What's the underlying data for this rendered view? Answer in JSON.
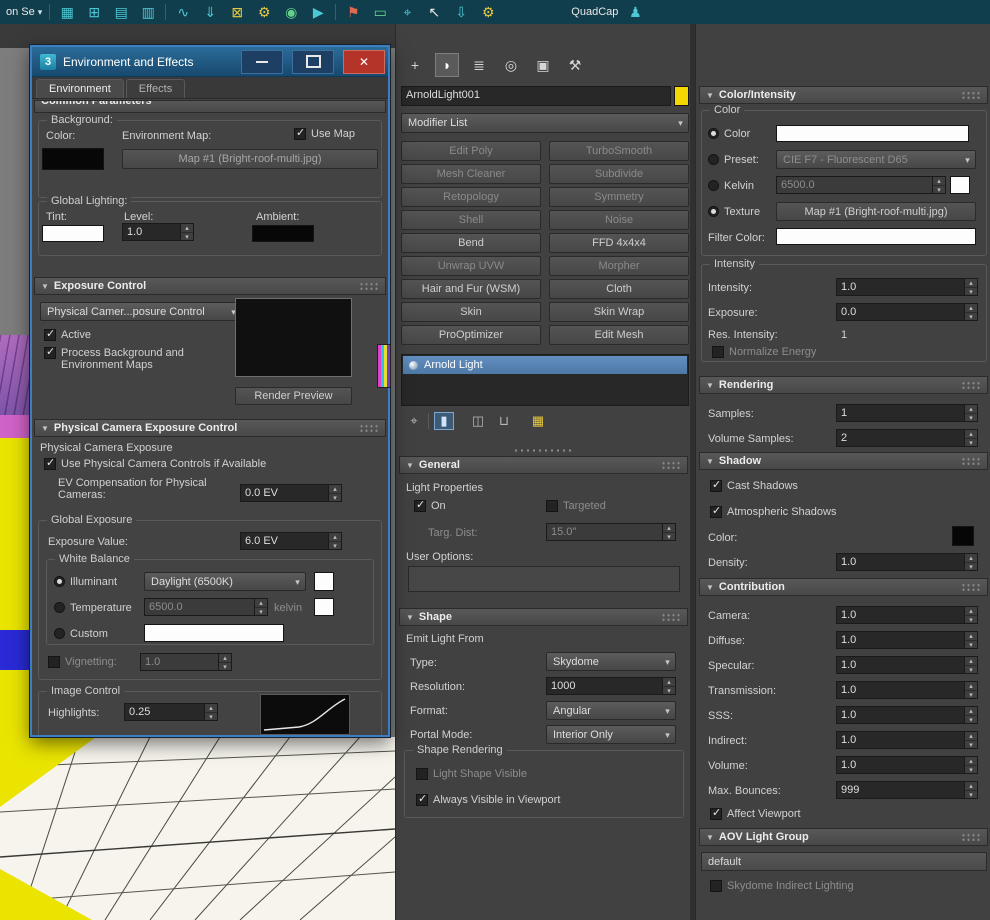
{
  "colors": {
    "accent_blue": "#4d79a7",
    "title_bar_blue": "#1c5a86",
    "close_red": "#b5342a",
    "object_color_yellow": "#f5d800",
    "toolbar_teal": "#113e4d",
    "icon_teal": "#4cc8d4"
  },
  "top_toolbar": {
    "selection_label": "on Se",
    "quadcap_label": "QuadCap",
    "icons": [
      {
        "name": "viewport-layout-icon",
        "glyph": "▦"
      },
      {
        "name": "schematic-view-icon",
        "glyph": "⊞"
      },
      {
        "name": "layer-explorer-icon",
        "glyph": "▤"
      },
      {
        "name": "scene-explorer-icon",
        "glyph": "▥"
      },
      {
        "name": "curve-editor-icon",
        "glyph": "∿"
      },
      {
        "name": "import-icon",
        "glyph": "⇓"
      },
      {
        "name": "uv-editor-icon",
        "glyph": "⊠"
      },
      {
        "name": "gear-icon",
        "glyph": "⚙"
      },
      {
        "name": "camera-icon",
        "glyph": "◉"
      },
      {
        "name": "play-icon",
        "glyph": "▶"
      },
      {
        "name": "flag-icon",
        "glyph": "⚑"
      },
      {
        "name": "monitor-icon",
        "glyph": "▭"
      },
      {
        "name": "target-icon",
        "glyph": "⌖"
      },
      {
        "name": "cursor-icon",
        "glyph": "↖"
      },
      {
        "name": "export-icon",
        "glyph": "⇩"
      },
      {
        "name": "gears-icon",
        "glyph": "⚙"
      }
    ],
    "quadcap_icon": {
      "name": "quadcap-icon",
      "glyph": "♟"
    }
  },
  "env_dialog": {
    "app_icon_glyph": "3",
    "title": "Environment and Effects",
    "tabs": {
      "environment": "Environment",
      "effects": "Effects"
    },
    "common_parameters_header": "Common Parameters",
    "background": {
      "title": "Background:",
      "color_label": "Color:",
      "env_map_label": "Environment Map:",
      "use_map_label": "Use Map",
      "use_map_checked": true,
      "map_button_label": "Map #1 (Bright-roof-multi.jpg)"
    },
    "global_lighting": {
      "title": "Global Lighting:",
      "tint_label": "Tint:",
      "level_label": "Level:",
      "level_value": "1.0",
      "ambient_label": "Ambient:"
    },
    "exposure_control": {
      "header": "Exposure Control",
      "mode_value": "Physical Camer...posure Control",
      "active_label": "Active",
      "active_checked": true,
      "process_label": "Process Background and Environment Maps",
      "process_checked": true,
      "render_preview_label": "Render Preview"
    },
    "physical": {
      "header": "Physical Camera Exposure Control",
      "subtitle": "Physical Camera Exposure",
      "use_controls_label": "Use Physical Camera Controls if Available",
      "use_controls_checked": true,
      "ev_comp_label": "EV Compensation for Physical Cameras:",
      "ev_comp_value": "0.0 EV",
      "global_exposure_title": "Global Exposure",
      "exposure_value_label": "Exposure Value:",
      "exposure_value": "6.0 EV",
      "white_balance_title": "White Balance",
      "illuminant_label": "Illuminant",
      "illuminant_value": "Daylight (6500K)",
      "temperature_label": "Temperature",
      "temperature_value": "6500.0",
      "kelvin_suffix": "kelvin",
      "custom_label": "Custom",
      "vignetting_label": "Vignetting:",
      "vignetting_value": "1.0",
      "vignetting_checked": false,
      "image_control_title": "Image Control",
      "highlights_label": "Highlights:",
      "highlights_value": "0.25"
    }
  },
  "command_panel": {
    "tabs": [
      {
        "name": "create-tab-icon",
        "glyph": "+"
      },
      {
        "name": "modify-tab-icon",
        "glyph": "◗"
      },
      {
        "name": "hierarchy-tab-icon",
        "glyph": "≣"
      },
      {
        "name": "motion-tab-icon",
        "glyph": "◎"
      },
      {
        "name": "display-tab-icon",
        "glyph": "▣"
      },
      {
        "name": "utilities-tab-icon",
        "glyph": "⚒"
      }
    ],
    "object_name": "ArnoldLight001",
    "modifier_list_label": "Modifier List",
    "modifier_buttons": [
      {
        "label": "Edit Poly",
        "enabled": false
      },
      {
        "label": "TurboSmooth",
        "enabled": false
      },
      {
        "label": "Mesh Cleaner",
        "enabled": false
      },
      {
        "label": "Subdivide",
        "enabled": false
      },
      {
        "label": "Retopology",
        "enabled": false
      },
      {
        "label": "Symmetry",
        "enabled": false
      },
      {
        "label": "Shell",
        "enabled": false
      },
      {
        "label": "Noise",
        "enabled": false
      },
      {
        "label": "Bend",
        "enabled": true
      },
      {
        "label": "FFD 4x4x4",
        "enabled": true
      },
      {
        "label": "Unwrap UVW",
        "enabled": false
      },
      {
        "label": "Morpher",
        "enabled": false
      },
      {
        "label": "Hair and Fur (WSM)",
        "enabled": true
      },
      {
        "label": "Cloth",
        "enabled": true
      },
      {
        "label": "Skin",
        "enabled": true
      },
      {
        "label": "Skin Wrap",
        "enabled": true
      },
      {
        "label": "ProOptimizer",
        "enabled": true
      },
      {
        "label": "Edit Mesh",
        "enabled": true
      }
    ],
    "stack_selected_label": "Arnold Light",
    "stack_toolbar": [
      {
        "name": "pin-stack-icon",
        "glyph": "⌖"
      },
      {
        "name": "show-end-result-icon",
        "glyph": "▮"
      },
      {
        "name": "make-unique-icon",
        "glyph": "◫"
      },
      {
        "name": "remove-modifier-icon",
        "glyph": "⊔"
      },
      {
        "name": "configure-modifier-sets-icon",
        "glyph": "▦"
      }
    ],
    "general": {
      "header": "General",
      "light_properties_label": "Light Properties",
      "on_label": "On",
      "on_checked": true,
      "targeted_label": "Targeted",
      "targeted_checked": false,
      "targ_dist_label": "Targ. Dist:",
      "targ_dist_value": "15.0\"",
      "user_options_label": "User Options:"
    },
    "shape": {
      "header": "Shape",
      "emit_label": "Emit Light From",
      "type_label": "Type:",
      "type_value": "Skydome",
      "resolution_label": "Resolution:",
      "resolution_value": "1000",
      "format_label": "Format:",
      "format_value": "Angular",
      "portal_label": "Portal Mode:",
      "portal_value": "Interior Only",
      "shape_rendering_title": "Shape Rendering",
      "light_shape_visible_label": "Light Shape Visible",
      "light_shape_visible_checked": false,
      "always_visible_label": "Always Visible in Viewport",
      "always_visible_checked": true
    }
  },
  "light_panel": {
    "color_intensity": {
      "header": "Color/Intensity",
      "color_group_title": "Color",
      "color_label": "Color",
      "preset_label": "Preset:",
      "preset_value": "CIE F7 - Fluorescent D65",
      "kelvin_label": "Kelvin",
      "kelvin_value": "6500.0",
      "texture_label": "Texture",
      "texture_value": "Map #1 (Bright-roof-multi.jpg)",
      "selected_mode": "texture",
      "filter_color_label": "Filter Color:",
      "intensity_group_title": "Intensity",
      "intensity_label": "Intensity:",
      "intensity_value": "1.0",
      "exposure_label": "Exposure:",
      "exposure_value": "0.0",
      "res_intensity_label": "Res. Intensity:",
      "res_intensity_value": "1",
      "normalize_label": "Normalize Energy",
      "normalize_checked": false
    },
    "rendering": {
      "header": "Rendering",
      "samples_label": "Samples:",
      "samples_value": "1",
      "volume_samples_label": "Volume Samples:",
      "volume_samples_value": "2"
    },
    "shadow": {
      "header": "Shadow",
      "cast_label": "Cast Shadows",
      "cast_checked": true,
      "atmospheric_label": "Atmospheric Shadows",
      "atmospheric_checked": true,
      "color_label": "Color:",
      "density_label": "Density:",
      "density_value": "1.0"
    },
    "contribution": {
      "header": "Contribution",
      "rows": [
        {
          "label": "Camera:",
          "value": "1.0"
        },
        {
          "label": "Diffuse:",
          "value": "1.0"
        },
        {
          "label": "Specular:",
          "value": "1.0"
        },
        {
          "label": "Transmission:",
          "value": "1.0"
        },
        {
          "label": "SSS:",
          "value": "1.0"
        },
        {
          "label": "Indirect:",
          "value": "1.0"
        },
        {
          "label": "Volume:",
          "value": "1.0"
        },
        {
          "label": "Max. Bounces:",
          "value": "999"
        }
      ],
      "affect_viewport_label": "Affect Viewport",
      "affect_viewport_checked": true
    },
    "aov": {
      "header": "AOV Light Group",
      "group_value": "default",
      "skydome_label": "Skydome Indirect Lighting",
      "skydome_checked": false
    }
  }
}
